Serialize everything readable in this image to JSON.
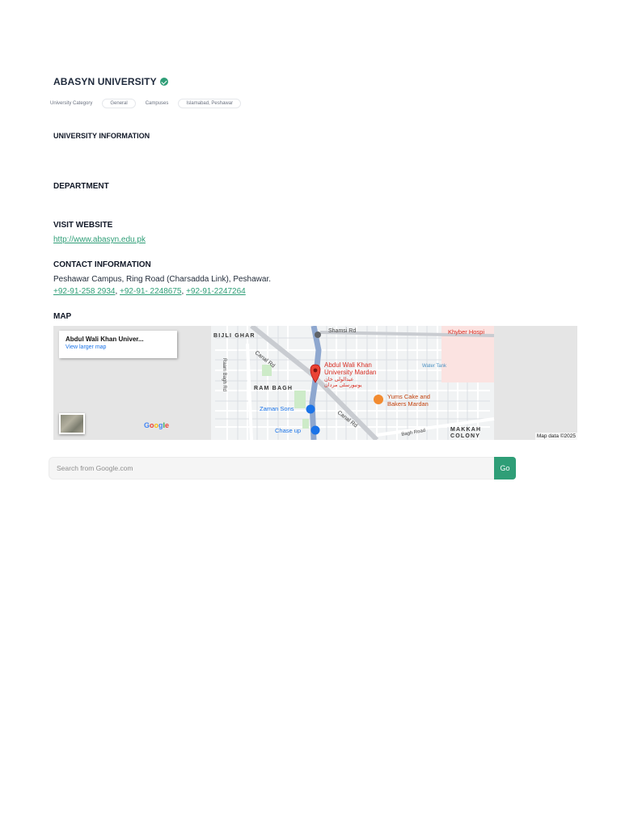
{
  "university": {
    "name": "ABASYN UNIVERSITY",
    "verified_icon": "check-circle-icon"
  },
  "meta": {
    "category_label": "University Category",
    "category_value": "General",
    "campuses_label": "Campuses",
    "campuses_value": "Islamabad, Peshawar"
  },
  "sections": {
    "info": "UNIVERSITY INFORMATION",
    "department": "DEPARTMENT",
    "website": "VISIT WEBSITE",
    "contact": "CONTACT INFORMATION",
    "map": "MAP"
  },
  "website_url": "http://www.abasyn.edu.pk",
  "contact": {
    "address": "Peshawar Campus, Ring Road (Charsadda Link), Peshawar.",
    "phones": [
      "+92-91-258 2934",
      "+92-91- 2248675",
      "+92-91-2247264"
    ],
    "separator": ", "
  },
  "map": {
    "card_title": "Abdul Wali Khan Univer...",
    "card_link": "View larger map",
    "attribution": "Map data ©2025",
    "google": [
      "G",
      "o",
      "o",
      "g",
      "l",
      "e"
    ],
    "google_colors": [
      "#4285F4",
      "#EA4335",
      "#FBBC05",
      "#4285F4",
      "#34A853",
      "#EA4335"
    ],
    "labels": {
      "bijli_ghar": "BIJLI GHAR",
      "shamsi_rd": "Shamsi Rd",
      "khyber": "Khyber Hospi",
      "raam_bagh_rd": "Raam Bagh Rd",
      "canal_rd_1": "Canal Rd",
      "canal_rd_2": "Canal Rd",
      "awku_1": "Abdul Wali Khan",
      "awku_2": "University Mardan",
      "awku_urdu_1": "عبدالولی خان",
      "awku_urdu_2": "یونیورسٹی مردان",
      "water_tank": "Water Tank",
      "ram_bagh": "RAM BAGH",
      "yums_1": "Yums Cake and",
      "yums_2": "Bakers Mardan",
      "zaman": "Zaman Sons",
      "chase": "Chase up",
      "makkah_1": "MAKKAH",
      "makkah_2": "COLONY",
      "bagh_road": "Bagh Road"
    }
  },
  "search": {
    "placeholder": "Search from Google.com",
    "button": "Go"
  }
}
